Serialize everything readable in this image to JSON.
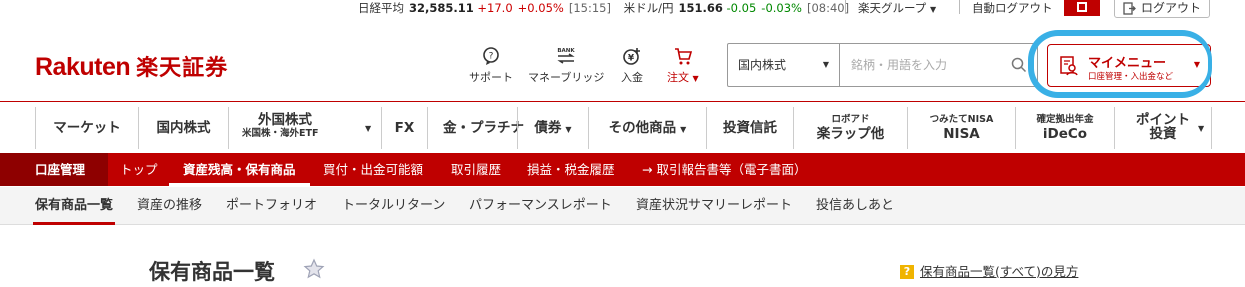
{
  "ticker": {
    "nikkei_label": "日経平均",
    "nikkei_value": "32,585.11",
    "nikkei_change": "+17.0",
    "nikkei_pct": "+0.05%",
    "nikkei_time": "[15:15]",
    "usd_label": "米ドル/円",
    "usd_value": "151.66",
    "usd_change": "-0.05",
    "usd_pct": "-0.03%",
    "usd_time": "[08:40]"
  },
  "top_links": {
    "group": "楽天グループ",
    "auto_logout": "自動ログアウト",
    "logout": "ログアウト"
  },
  "logo": {
    "en": "Rakuten",
    "jp": "楽天証券"
  },
  "header_icons": [
    {
      "label": "サポート",
      "icon": "support-icon"
    },
    {
      "label": "マネーブリッジ",
      "icon": "bank-icon"
    },
    {
      "label": "入金",
      "icon": "deposit-icon"
    },
    {
      "label": "注文",
      "icon": "cart-icon"
    }
  ],
  "search": {
    "market": "国内株式",
    "placeholder": "銘柄・用語を入力"
  },
  "mymenu": {
    "title": "マイメニュー",
    "sub": "口座管理・入出金など"
  },
  "global_nav": [
    {
      "label": "マーケット"
    },
    {
      "label": "国内株式"
    },
    {
      "label": "外国株式",
      "sub": "米国株・海外ETF"
    },
    {
      "label": "FX"
    },
    {
      "label": "金・プラチナ"
    },
    {
      "label": "債券"
    },
    {
      "label": "その他商品"
    },
    {
      "label": "投資信託"
    },
    {
      "label": "ロボアド",
      "label2": "楽ラップ他"
    },
    {
      "label": "つみたてNISA",
      "label2": "NISA"
    },
    {
      "label": "確定拠出年金",
      "label2": "iDeCo"
    },
    {
      "label": "ポイント",
      "label2": "投資"
    }
  ],
  "account_nav": {
    "label": "口座管理",
    "items": [
      "トップ",
      "資産残高・保有商品",
      "買付・出金可能額",
      "取引履歴",
      "損益・税金履歴",
      "→ 取引報告書等（電子書面）"
    ]
  },
  "sub_nav": [
    "保有商品一覧",
    "資産の推移",
    "ポートフォリオ",
    "トータルリターン",
    "パフォーマンスレポート",
    "資産状況サマリーレポート",
    "投信あしあと"
  ],
  "page": {
    "title": "保有商品一覧",
    "help_mark": "?",
    "help_link": "保有商品一覧(すべて)の見方"
  },
  "colors": {
    "brand": "#bf0000",
    "highlight": "#39b0e6"
  }
}
